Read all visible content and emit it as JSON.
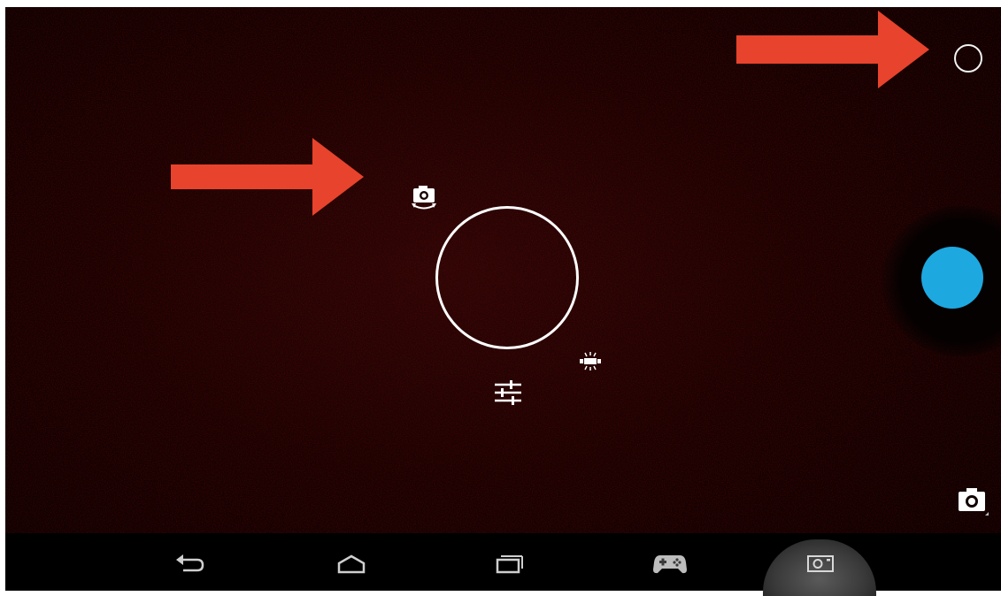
{
  "app": {
    "name": "Camera"
  },
  "overlay": {
    "annotation_arrow_color": "#e8432c"
  },
  "controls": {
    "top_ring_icon": "ring-icon",
    "switch_camera_icon": "switch-camera-icon",
    "flash_icon": "flash-icon",
    "settings_icon": "settings-sliders-icon",
    "mode_icon": "camera-mode-icon",
    "shutter_color": "#1ea8e0"
  },
  "navbar": {
    "items": [
      {
        "icon": "back-icon"
      },
      {
        "icon": "home-icon"
      },
      {
        "icon": "recent-apps-icon"
      },
      {
        "icon": "gamepad-icon"
      },
      {
        "icon": "screenshot-camera-icon",
        "active": true
      }
    ]
  }
}
